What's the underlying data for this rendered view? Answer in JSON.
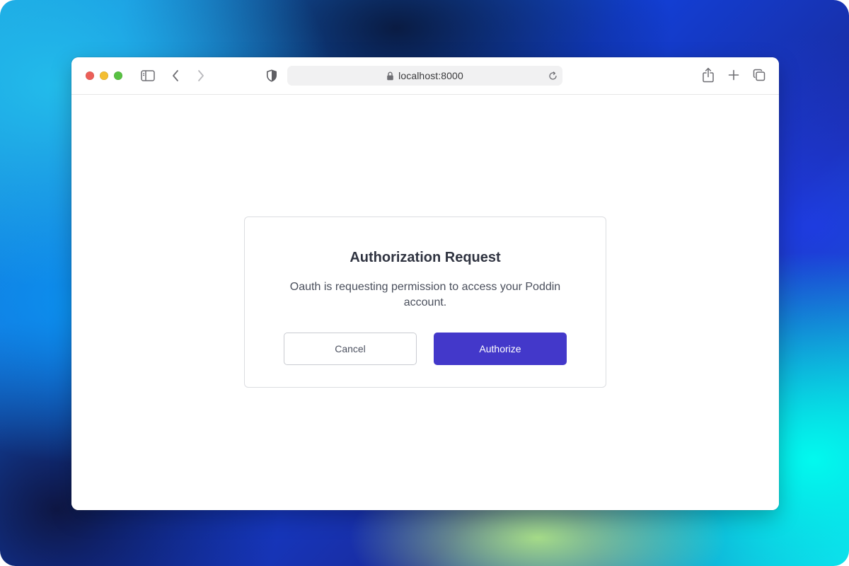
{
  "browser": {
    "address": "localhost:8000",
    "icons": {
      "sidebar": "sidebar-icon",
      "back": "chevron-left-icon",
      "forward": "chevron-right-icon",
      "privacy": "shield-icon",
      "lock": "lock-icon",
      "reload": "reload-icon",
      "share": "share-icon",
      "new_tab": "plus-icon",
      "tabs": "tabs-overview-icon"
    },
    "traffic_light_colors": {
      "close": "#ec5f58",
      "minimize": "#f3be32",
      "zoom": "#58c142"
    }
  },
  "dialog": {
    "title": "Authorization Request",
    "message": "Oauth is requesting permission to access your Poddin account.",
    "cancel_label": "Cancel",
    "authorize_label": "Authorize",
    "accent_color": "#4338ca"
  }
}
